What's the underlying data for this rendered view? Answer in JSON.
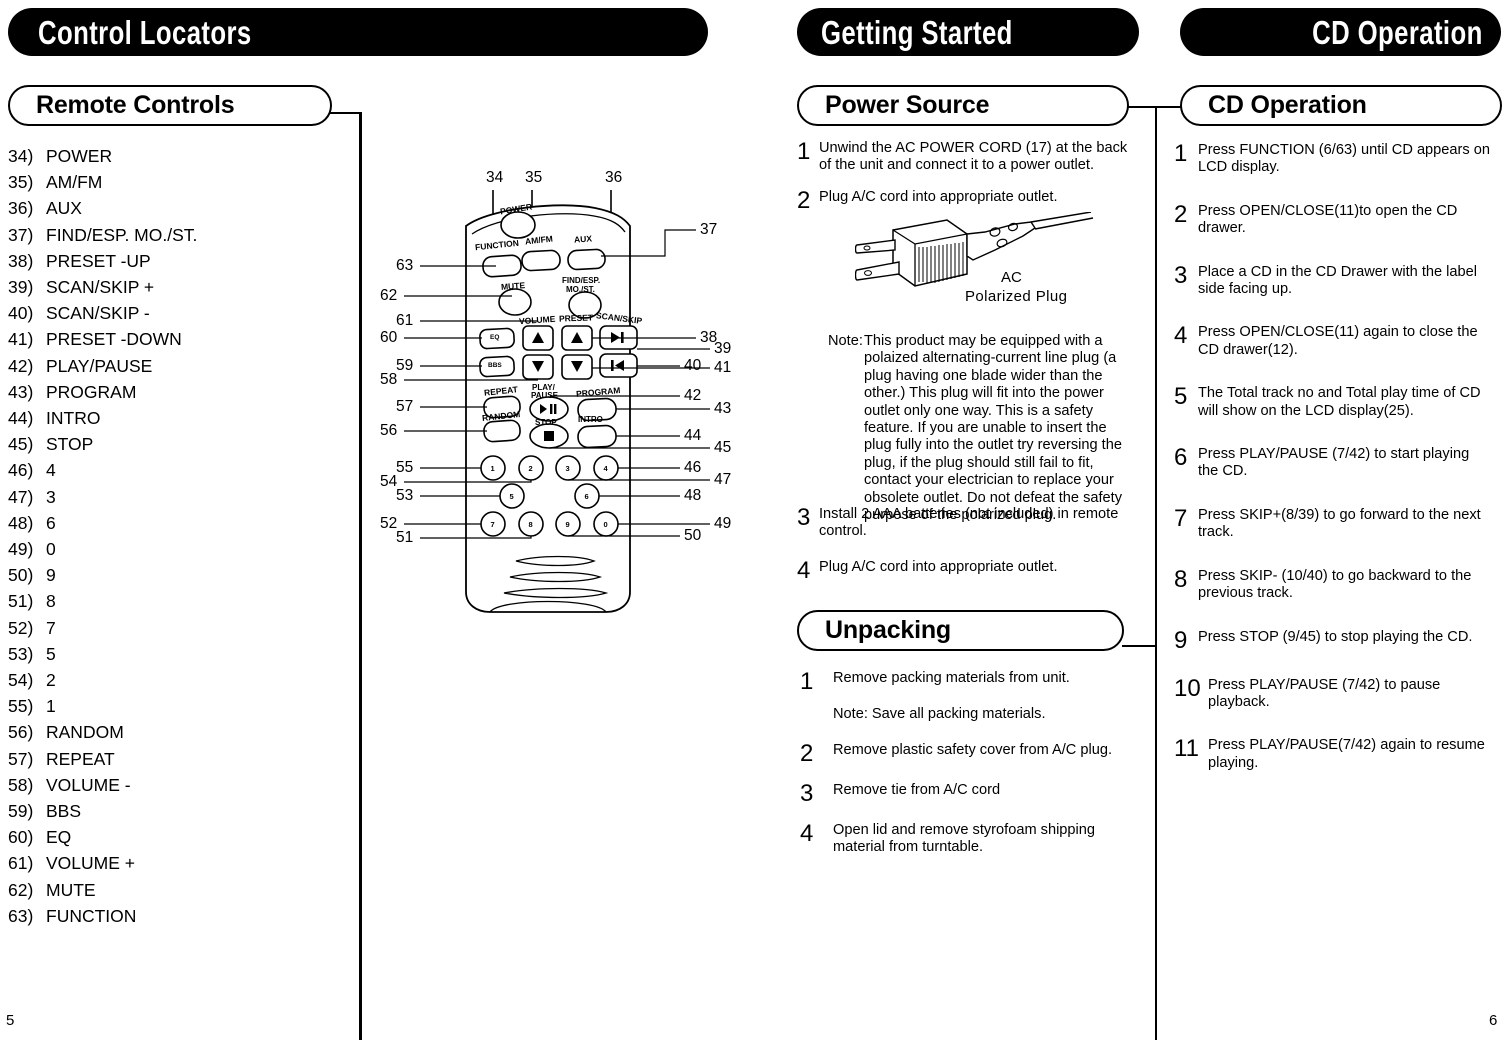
{
  "banners": [
    {
      "id": "control-locators",
      "label": "Control Locators"
    },
    {
      "id": "getting-started",
      "label": "Getting Started"
    },
    {
      "id": "cd-operation",
      "label": "CD Operation"
    }
  ],
  "pills": [
    {
      "id": "remote-controls",
      "label": "Remote Controls"
    },
    {
      "id": "power-source",
      "label": "Power Source"
    },
    {
      "id": "unpacking",
      "label": "Unpacking"
    },
    {
      "id": "cd-operation",
      "label": "CD Operation"
    }
  ],
  "control_locators": [
    {
      "num": "34)",
      "label": "POWER"
    },
    {
      "num": "35)",
      "label": "AM/FM"
    },
    {
      "num": "36)",
      "label": "AUX"
    },
    {
      "num": "37)",
      "label": "FIND/ESP. MO./ST."
    },
    {
      "num": "38)",
      "label": "PRESET -UP"
    },
    {
      "num": "39)",
      "label": "SCAN/SKIP +"
    },
    {
      "num": "40)",
      "label": "SCAN/SKIP -"
    },
    {
      "num": "41)",
      "label": "PRESET -DOWN"
    },
    {
      "num": "42)",
      "label": "PLAY/PAUSE"
    },
    {
      "num": "43)",
      "label": "PROGRAM"
    },
    {
      "num": "44)",
      "label": "INTRO"
    },
    {
      "num": "45)",
      "label": "STOP"
    },
    {
      "num": "46)",
      "label": "4"
    },
    {
      "num": "47)",
      "label": "3"
    },
    {
      "num": "48)",
      "label": "6"
    },
    {
      "num": "49)",
      "label": "0"
    },
    {
      "num": "50)",
      "label": "9"
    },
    {
      "num": "51)",
      "label": "8"
    },
    {
      "num": "52)",
      "label": "7"
    },
    {
      "num": "53)",
      "label": "5"
    },
    {
      "num": "54)",
      "label": "2"
    },
    {
      "num": "55)",
      "label": "1"
    },
    {
      "num": "56)",
      "label": "RANDOM"
    },
    {
      "num": "57)",
      "label": "REPEAT"
    },
    {
      "num": "58)",
      "label": "VOLUME -"
    },
    {
      "num": "59)",
      "label": "BBS"
    },
    {
      "num": "60)",
      "label": "EQ"
    },
    {
      "num": "61)",
      "label": "VOLUME +"
    },
    {
      "num": "62)",
      "label": "MUTE"
    },
    {
      "num": "63)",
      "label": "FUNCTION"
    }
  ],
  "remote_diagram": {
    "button_labels": {
      "power": "POWER",
      "function": "FUNCTION",
      "amfm": "AM/FM",
      "aux": "AUX",
      "mute": "MUTE",
      "find_esp": "FIND/ESP.",
      "find_esp2": "MO./ST.",
      "volume": "VOLUME",
      "preset": "PRESET",
      "scan_skip": "SCAN/SKIP",
      "eq": "EQ",
      "bbs": "BBS",
      "repeat": "REPEAT",
      "random": "RANDOM",
      "play_pause1": "PLAY/",
      "play_pause2": "PAUSE",
      "program": "PROGRAM",
      "stop": "STOP",
      "intro": "INTRO",
      "keys": [
        "1",
        "2",
        "3",
        "4",
        "5",
        "6",
        "7",
        "8",
        "9",
        "0"
      ]
    },
    "callouts_top": [
      "34",
      "35",
      "36"
    ],
    "callouts_left": [
      "63",
      "62",
      "61",
      "60",
      "59",
      "58",
      "57",
      "56",
      "55",
      "54",
      "53",
      "52",
      "51"
    ],
    "callouts_right": [
      "37",
      "38",
      "39",
      "40",
      "41",
      "42",
      "43",
      "44",
      "45",
      "46",
      "47",
      "48",
      "49",
      "50"
    ]
  },
  "power_source": {
    "steps": [
      {
        "n": "1",
        "text": "Unwind the AC POWER CORD (17) at the back of the unit and connect it to a power outlet."
      },
      {
        "n": "2",
        "text": "Plug A/C cord into appropriate outlet."
      }
    ],
    "figure": {
      "caption_line1": "AC",
      "caption_line2": "Polarized Plug",
      "name": "ac-polarized-plug"
    },
    "note": {
      "label": "Note:",
      "text": "This product may be equipped with a polaized alternating-current line plug (a plug having one blade wider than the other.) This plug will fit into the power outlet only one way. This is a safety feature. If you are unable to insert the plug fully into the outlet try reversing the plug, if the plug should still fail to fit, contact your electrician to replace your obsolete outlet. Do not defeat the safety purpose of the polarized plug."
    },
    "steps_after": [
      {
        "n": "3",
        "text": "Install 2 AAA batteries (not included) in remote control."
      },
      {
        "n": "4",
        "text": "Plug A/C cord into appropriate outlet."
      }
    ]
  },
  "unpacking": {
    "steps": [
      {
        "n": "1",
        "text": "Remove packing materials from unit.",
        "note": "Note: Save all packing materials."
      },
      {
        "n": "2",
        "text": "Remove plastic safety cover from A/C plug."
      },
      {
        "n": "3",
        "text": "Remove tie from A/C cord"
      },
      {
        "n": "4",
        "text": "Open lid and remove styrofoam shipping material from turntable."
      }
    ]
  },
  "cd_operation": {
    "steps": [
      {
        "n": "1",
        "text": "Press FUNCTION (6/63) until CD appears on LCD display."
      },
      {
        "n": "2",
        "text": "Press OPEN/CLOSE(11)to open the CD drawer."
      },
      {
        "n": "3",
        "text": "Place a CD in the CD Drawer with the label side facing up."
      },
      {
        "n": "4",
        "text": "Press OPEN/CLOSE(11) again to close the CD drawer(12)."
      },
      {
        "n": "5",
        "text": "The Total track no and Total play time of CD will show on the LCD display(25)."
      },
      {
        "n": "6",
        "text": "Press PLAY/PAUSE (7/42) to start playing the CD."
      },
      {
        "n": "7",
        "text": "Press SKIP+(8/39) to go forward to the next track."
      },
      {
        "n": "8",
        "text": "Press SKIP- (10/40) to go backward to the previous track."
      },
      {
        "n": "9",
        "text": "Press STOP (9/45) to stop playing the CD."
      },
      {
        "n": "10",
        "text": "Press PLAY/PAUSE (7/42) to pause playback."
      },
      {
        "n": "11",
        "text": "Press PLAY/PAUSE(7/42) again to resume playing."
      }
    ]
  },
  "page_numbers": {
    "left": "5",
    "right": "6"
  },
  "colors": {
    "banner_bg": "#000000",
    "banner_text": "#ffffff",
    "body_text": "#000000",
    "page_bg": "#ffffff"
  }
}
